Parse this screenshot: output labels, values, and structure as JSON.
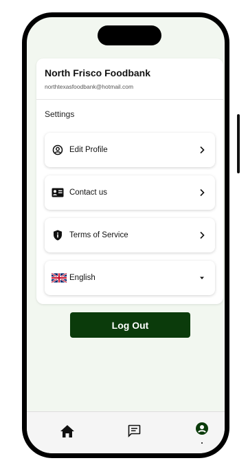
{
  "profile": {
    "org_name": "North Frisco Foodbank",
    "email": "northtexasfoodbank@hotmail.com"
  },
  "settings": {
    "heading": "Settings",
    "items": [
      {
        "label": "Edit Profile",
        "icon": "user-circle-icon"
      },
      {
        "label": "Contact us",
        "icon": "contact-card-icon"
      },
      {
        "label": "Terms of Service",
        "icon": "shield-icon"
      },
      {
        "label": "English",
        "icon": "uk-flag-icon"
      }
    ]
  },
  "actions": {
    "logout_label": "Log Out"
  },
  "colors": {
    "primary": "#0b3b0b",
    "background": "#f2f7f0",
    "active_tab": "#0b3b0b"
  },
  "tabbar": {
    "tabs": [
      {
        "icon": "home-icon"
      },
      {
        "icon": "message-icon"
      },
      {
        "icon": "profile-icon",
        "active": true
      }
    ]
  }
}
